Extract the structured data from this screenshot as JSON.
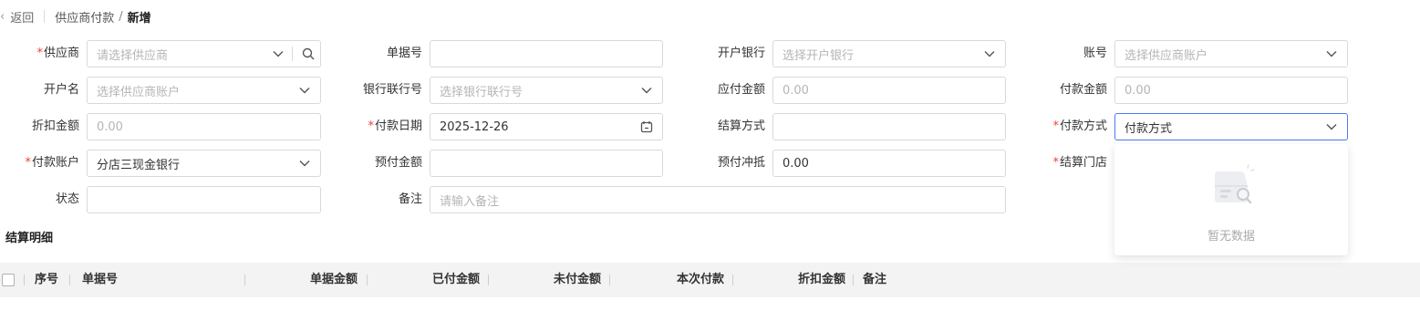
{
  "header": {
    "back_label": "返回",
    "breadcrumb_parent": "供应商付款",
    "breadcrumb_separator": "/",
    "breadcrumb_current": "新增"
  },
  "form": {
    "supplier": {
      "label": "供应商",
      "required": true,
      "placeholder": "请选择供应商"
    },
    "doc_no": {
      "label": "单据号",
      "value": ""
    },
    "bank": {
      "label": "开户银行",
      "placeholder": "选择开户银行"
    },
    "account_no": {
      "label": "账号",
      "placeholder": "选择供应商账户"
    },
    "account_name": {
      "label": "开户名",
      "placeholder": "选择供应商账户"
    },
    "bank_union_no": {
      "label": "银行联行号",
      "placeholder": "选择银行联行号"
    },
    "payable_amount": {
      "label": "应付金额",
      "value": "0.00"
    },
    "payment_amount": {
      "label": "付款金额",
      "value": "0.00"
    },
    "discount_amount": {
      "label": "折扣金额",
      "value": "0.00"
    },
    "payment_date": {
      "label": "付款日期",
      "required": true,
      "value": "2025-12-26"
    },
    "settlement_method": {
      "label": "结算方式",
      "value": ""
    },
    "payment_method": {
      "label": "付款方式",
      "required": true,
      "value": "付款方式"
    },
    "payment_account": {
      "label": "付款账户",
      "required": true,
      "value": "分店三现金银行"
    },
    "prepaid_amount": {
      "label": "预付金额",
      "value": ""
    },
    "prepaid_offset": {
      "label": "预付冲抵",
      "value": "0.00"
    },
    "settlement_store": {
      "label": "结算门店",
      "required": true
    },
    "status": {
      "label": "状态",
      "value": ""
    },
    "remark": {
      "label": "备注",
      "placeholder": "请输入备注"
    }
  },
  "dropdown": {
    "empty_text": "暂无数据"
  },
  "section": {
    "title": "结算明细"
  },
  "table": {
    "columns": [
      "序号",
      "单据号",
      "单据金额",
      "已付金额",
      "未付金额",
      "本次付款",
      "折扣金额",
      "备注"
    ]
  },
  "colors": {
    "required": "#f04134",
    "focus_border": "#4a7bf2",
    "header_bg": "#f3f3f3"
  },
  "icons": [
    "chevron-left-icon",
    "chevron-down-icon",
    "search-icon",
    "calendar-icon",
    "empty-box-icon"
  ]
}
